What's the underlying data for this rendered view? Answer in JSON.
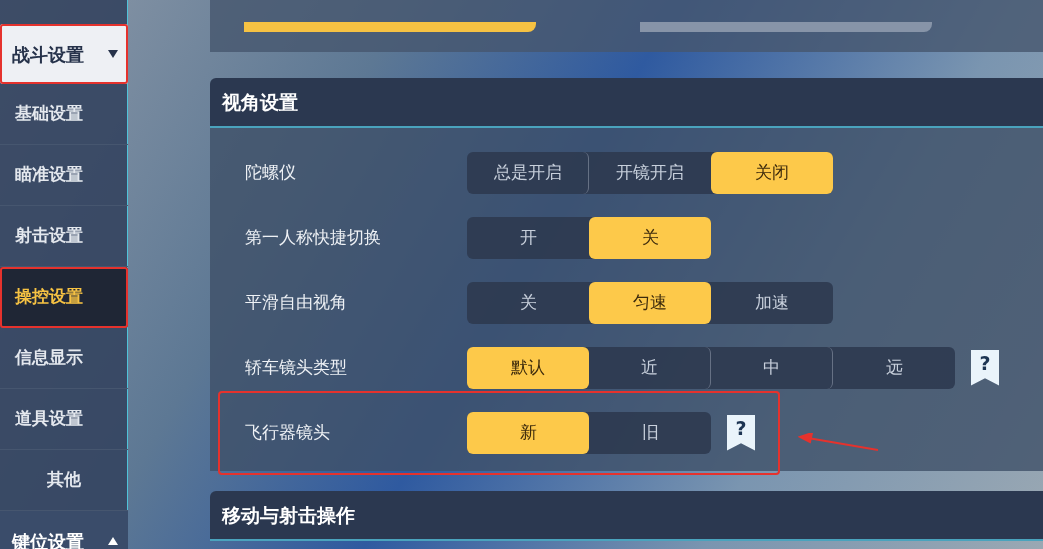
{
  "sidebar": {
    "groups": [
      {
        "label": "战斗设置",
        "expanded": true,
        "annotated": true,
        "items": [
          {
            "label": "基础设置",
            "selected": false,
            "annotated": false
          },
          {
            "label": "瞄准设置",
            "selected": false,
            "annotated": false
          },
          {
            "label": "射击设置",
            "selected": false,
            "annotated": false
          },
          {
            "label": "操控设置",
            "selected": true,
            "annotated": true
          },
          {
            "label": "信息显示",
            "selected": false,
            "annotated": false
          },
          {
            "label": "道具设置",
            "selected": false,
            "annotated": false
          },
          {
            "label": "其他",
            "selected": false,
            "annotated": false
          }
        ]
      },
      {
        "label": "键位设置",
        "expanded": false,
        "annotated": false
      }
    ]
  },
  "top_remnant": [
    {
      "selected": true
    },
    {
      "selected": false
    }
  ],
  "sections": [
    {
      "title": "视角设置",
      "rows": [
        {
          "label": "陀螺仪",
          "annotated": false,
          "options": [
            {
              "label": "总是开启",
              "selected": false
            },
            {
              "label": "开镜开启",
              "selected": false
            },
            {
              "label": "关闭",
              "selected": true
            }
          ]
        },
        {
          "label": "第一人称快捷切换",
          "annotated": false,
          "options": [
            {
              "label": "开",
              "selected": false
            },
            {
              "label": "关",
              "selected": true
            }
          ]
        },
        {
          "label": "平滑自由视角",
          "annotated": false,
          "options": [
            {
              "label": "关",
              "selected": false
            },
            {
              "label": "匀速",
              "selected": true
            },
            {
              "label": "加速",
              "selected": false
            }
          ]
        },
        {
          "label": "轿车镜头类型",
          "annotated": false,
          "help": "?",
          "options": [
            {
              "label": "默认",
              "selected": true
            },
            {
              "label": "近",
              "selected": false
            },
            {
              "label": "中",
              "selected": false
            },
            {
              "label": "远",
              "selected": false
            }
          ]
        },
        {
          "label": "飞行器镜头",
          "annotated": true,
          "help": "?",
          "options": [
            {
              "label": "新",
              "selected": true
            },
            {
              "label": "旧",
              "selected": false
            }
          ]
        }
      ]
    },
    {
      "title": "移动与射击操作"
    }
  ]
}
